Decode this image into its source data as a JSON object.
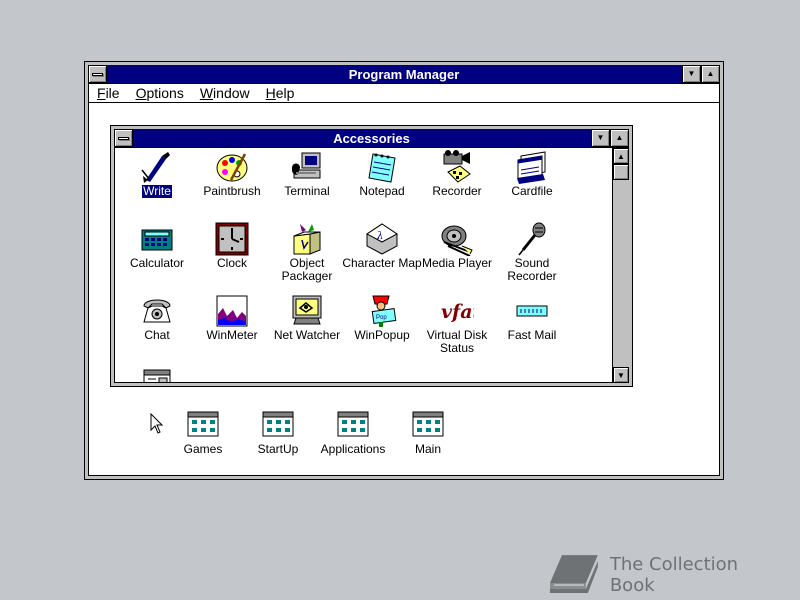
{
  "program_manager": {
    "title": "Program Manager",
    "menu": [
      {
        "ul": "F",
        "rest": "ile"
      },
      {
        "ul": "O",
        "rest": "ptions"
      },
      {
        "ul": "W",
        "rest": "indow"
      },
      {
        "ul": "H",
        "rest": "elp"
      }
    ]
  },
  "accessories": {
    "title": "Accessories",
    "icons": [
      {
        "label": "Write",
        "icon": "write-icon",
        "selected": true
      },
      {
        "label": "Paintbrush",
        "icon": "paintbrush-icon"
      },
      {
        "label": "Terminal",
        "icon": "terminal-icon"
      },
      {
        "label": "Notepad",
        "icon": "notepad-icon"
      },
      {
        "label": "Recorder",
        "icon": "recorder-icon"
      },
      {
        "label": "Cardfile",
        "icon": "cardfile-icon"
      },
      {
        "label": "Calculator",
        "icon": "calculator-icon"
      },
      {
        "label": "Clock",
        "icon": "clock-icon"
      },
      {
        "label": "Object\nPackager",
        "icon": "object-packager-icon"
      },
      {
        "label": "Character Map",
        "icon": "character-map-icon"
      },
      {
        "label": "Media Player",
        "icon": "media-player-icon"
      },
      {
        "label": "Sound\nRecorder",
        "icon": "sound-recorder-icon"
      },
      {
        "label": "Chat",
        "icon": "chat-icon"
      },
      {
        "label": "WinMeter",
        "icon": "winmeter-icon"
      },
      {
        "label": "Net Watcher",
        "icon": "net-watcher-icon"
      },
      {
        "label": "WinPopup",
        "icon": "winpopup-icon"
      },
      {
        "label": "Virtual Disk\nStatus",
        "icon": "virtual-disk-icon"
      },
      {
        "label": "Fast Mail",
        "icon": "fast-mail-icon"
      }
    ]
  },
  "groups": [
    {
      "label": "Games",
      "icon": "program-group-icon"
    },
    {
      "label": "StartUp",
      "icon": "program-group-icon"
    },
    {
      "label": "Applications",
      "icon": "program-group-icon"
    },
    {
      "label": "Main",
      "icon": "program-group-icon"
    }
  ],
  "watermark": {
    "text": "The Collection Book",
    "icon": "book-icon"
  },
  "colors": {
    "title_active": "#000080",
    "desktop": "#c3c7cb",
    "face": "#c0c0c0"
  }
}
